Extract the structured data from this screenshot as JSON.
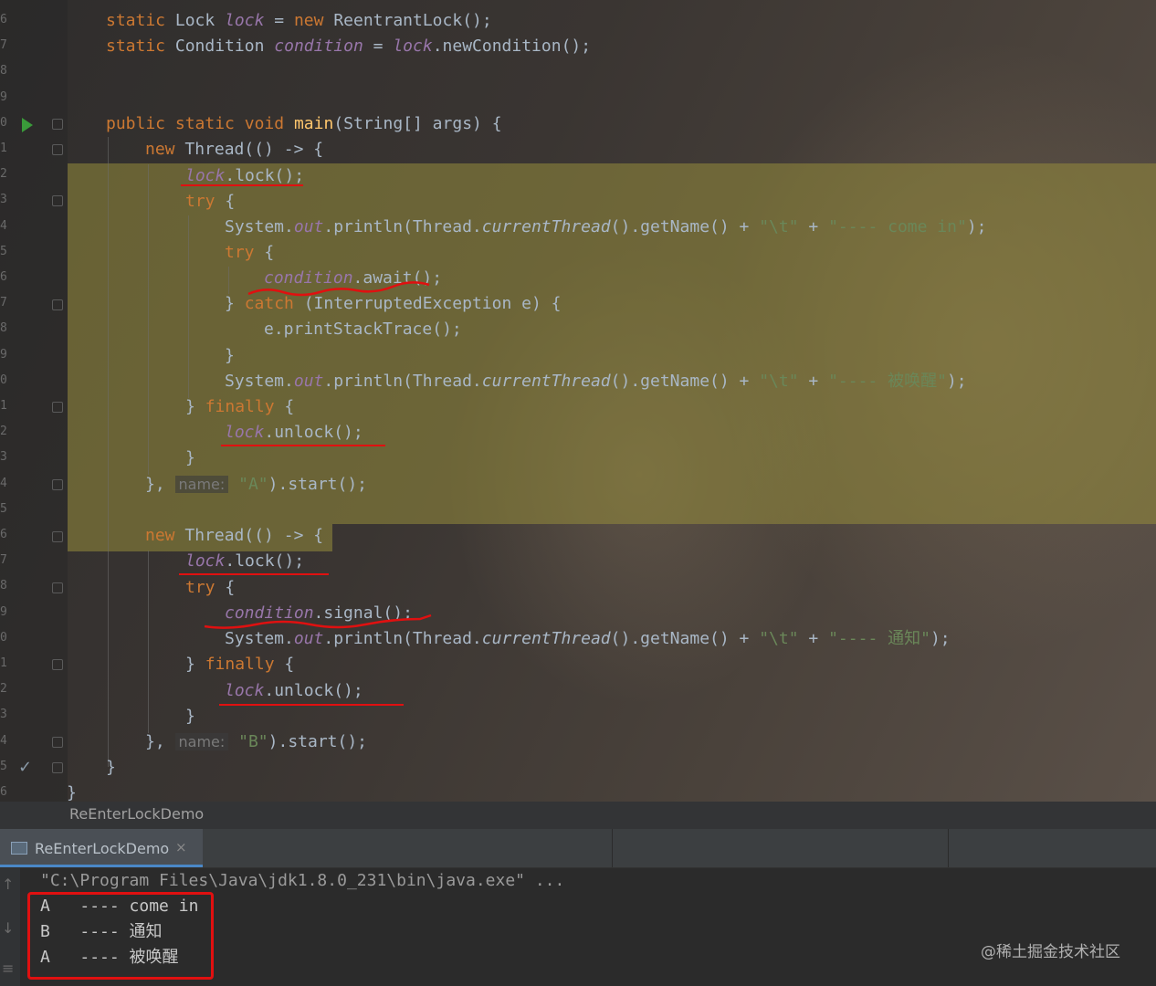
{
  "editor": {
    "gutter_numbers": [
      "6",
      "7",
      "8",
      "9",
      "0",
      "1",
      "2",
      "3",
      "4",
      "5",
      "6",
      "7",
      "8",
      "9",
      "0",
      "1",
      "2",
      "3",
      "4",
      "5",
      "6",
      "7",
      "8",
      "9",
      "0",
      "1",
      "2",
      "3",
      "4",
      "5",
      "6"
    ],
    "run_icon": "run-triangle-icon",
    "check_icon": "checkmark-icon",
    "hints": {
      "name_label": "name:"
    },
    "lines": {
      "l1_kw": "static",
      "l1_type": "Lock",
      "l1_var": "lock",
      "l1_eq": " = ",
      "l1_new": "new",
      "l1_rest": "ReentrantLock();",
      "l2_kw": "static",
      "l2_type": "Condition",
      "l2_var": "condition",
      "l2_eq": " = ",
      "l2_lock": "lock",
      "l2_rest": ".newCondition();",
      "main_pub": "public",
      "main_static": "static",
      "main_void": "void",
      "main_name": "main",
      "main_rest": "(String[] args) {",
      "a_new": "new",
      "a_rest": "Thread(() -> {",
      "a_lock_var": "lock",
      "a_lock_rest": ".lock();",
      "try": "try",
      "brace_open": " {",
      "print_sys": "System.",
      "print_out": "out",
      "print_mid": ".println(Thread.",
      "print_ct": "currentThread",
      "print_mid2": "().getName() + ",
      "tab_str": "\"\\t\"",
      "plus": " + ",
      "a_come_str": "\"---- come in\"",
      "close_paren": ");",
      "await_var": "condition",
      "await_rest": ".await();",
      "catch_close": "} ",
      "catch_kw": "catch",
      "catch_rest": " (InterruptedException e) {",
      "trace": "e.printStackTrace();",
      "brace_close": "}",
      "a_wake_str": "\"---- 被唤醒\"",
      "finally_close": "} ",
      "finally_kw": "finally",
      "unlock_var": "lock",
      "unlock_rest": ".unlock();",
      "end_a_pre": "}, ",
      "end_a_str": "\"A\"",
      "end_rest": ").start();",
      "b_new": "new",
      "b_rest": "Thread(() -> {",
      "signal_var": "condition",
      "signal_rest": ".signal();",
      "b_notify_str": "\"---- 通知\"",
      "end_b_str": "\"B\"",
      "main_close": "}",
      "class_close": "}"
    }
  },
  "breadcrumb": {
    "label": "ReEnterLockDemo"
  },
  "run_panel": {
    "tab_label": "ReEnterLockDemo",
    "tab_close": "×",
    "command": "\"C:\\Program Files\\Java\\jdk1.8.0_231\\bin\\java.exe\" ...",
    "output": [
      {
        "thread": "A",
        "text": "---- come in"
      },
      {
        "thread": "B",
        "text": "---- 通知"
      },
      {
        "thread": "A",
        "text": "---- 被唤醒"
      }
    ]
  },
  "watermark": "@稀土掘金技术社区",
  "colors": {
    "keyword": "#cc7832",
    "field": "#9876aa",
    "string": "#6a8759",
    "method": "#ffc66d",
    "annotation": "#e01010",
    "highlight": "#968c3c"
  }
}
